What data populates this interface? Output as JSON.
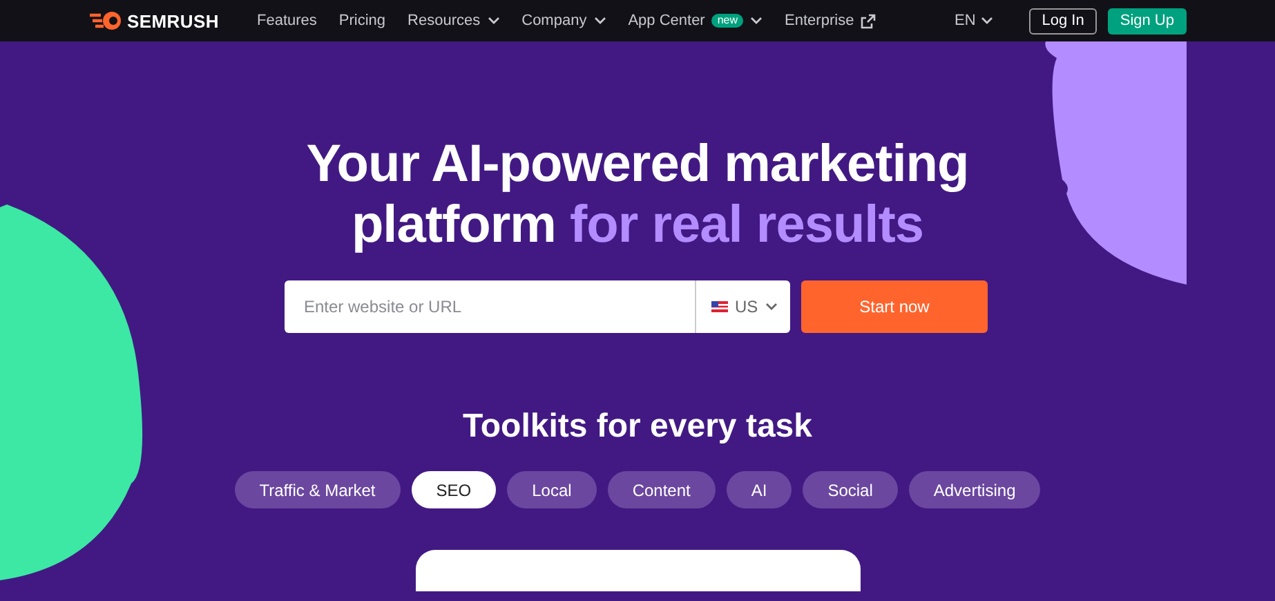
{
  "nav": {
    "logo": "SEMRUSH",
    "links": [
      {
        "label": "Features",
        "dropdown": false,
        "external": false
      },
      {
        "label": "Pricing",
        "dropdown": false,
        "external": false
      },
      {
        "label": "Resources",
        "dropdown": true,
        "external": false
      },
      {
        "label": "Company",
        "dropdown": true,
        "external": false
      },
      {
        "label": "App Center",
        "badge": "new",
        "dropdown": true,
        "external": false
      },
      {
        "label": "Enterprise",
        "dropdown": false,
        "external": true
      }
    ],
    "language": "EN",
    "login": "Log In",
    "signup": "Sign Up"
  },
  "hero": {
    "title_lines": [
      {
        "text": "Your AI-powered marketing"
      },
      {
        "text": "platform ",
        "highlight": "for real results"
      }
    ],
    "search": {
      "placeholder": "Enter website or URL",
      "country": "US"
    },
    "submit": "Start now"
  },
  "toolkits": {
    "title": "Toolkits for every task",
    "tabs": [
      {
        "label": "Traffic & Market",
        "selected": false
      },
      {
        "label": "SEO",
        "selected": true
      },
      {
        "label": "Local",
        "selected": false
      },
      {
        "label": "Content",
        "selected": false
      },
      {
        "label": "AI",
        "selected": false
      },
      {
        "label": "Social",
        "selected": false
      },
      {
        "label": "Advertising",
        "selected": false
      }
    ]
  }
}
